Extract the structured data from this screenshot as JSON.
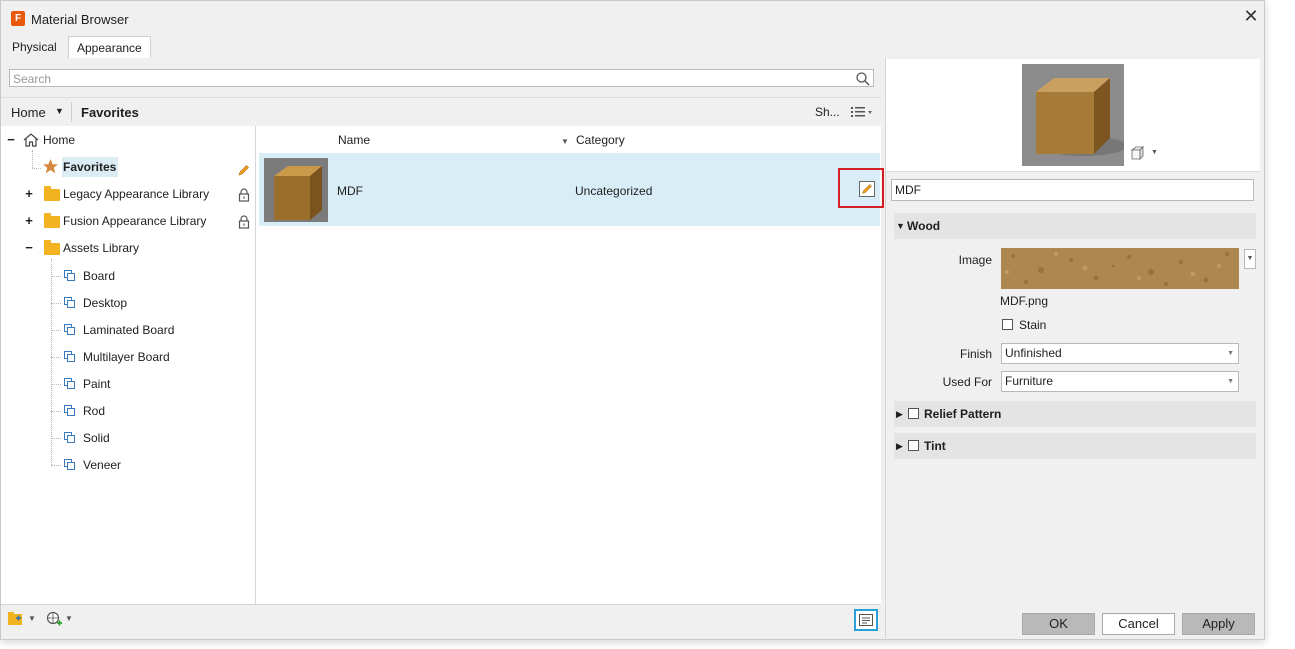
{
  "window": {
    "title": "Material Browser",
    "close_glyph": "✕"
  },
  "tabs": [
    {
      "label": "Physical"
    },
    {
      "label": "Appearance",
      "active": true
    }
  ],
  "search": {
    "placeholder": "Search",
    "value": ""
  },
  "breadcrumb": {
    "root": "Home",
    "current": "Favorites",
    "show_label": "Sh..."
  },
  "tree": {
    "home": {
      "label": "Home",
      "expanded": true
    },
    "favorites": {
      "label": "Favorites",
      "selected": true
    },
    "libraries": [
      {
        "label": "Legacy Appearance Library",
        "expanded": false,
        "locked": true
      },
      {
        "label": "Fusion Appearance Library",
        "expanded": false,
        "locked": true
      },
      {
        "label": "Assets Library",
        "expanded": true,
        "locked": false
      }
    ],
    "assets": [
      {
        "label": "Board"
      },
      {
        "label": "Desktop"
      },
      {
        "label": "Laminated Board"
      },
      {
        "label": "Multilayer Board"
      },
      {
        "label": "Paint"
      },
      {
        "label": "Rod"
      },
      {
        "label": "Solid"
      },
      {
        "label": "Veneer"
      }
    ],
    "expand_glyph": "+",
    "collapse_glyph": "−"
  },
  "list": {
    "columns": {
      "name": "Name",
      "category": "Category"
    },
    "rows": [
      {
        "name": "MDF",
        "category": "Uncategorized",
        "selected": true
      }
    ]
  },
  "editor": {
    "material_name": "MDF",
    "sections": {
      "wood": {
        "label": "Wood",
        "expanded": true
      },
      "relief": {
        "label": "Relief  Pattern",
        "checked": false,
        "expanded": false
      },
      "tint": {
        "label": "Tint",
        "checked": false,
        "expanded": false
      }
    },
    "image_label": "Image",
    "image_file": "MDF.png",
    "stain_label": "Stain",
    "stain_checked": false,
    "finish_label": "Finish",
    "finish_value": "Unfinished",
    "used_for_label": "Used For",
    "used_for_value": "Furniture"
  },
  "buttons": {
    "ok": "OK",
    "cancel": "Cancel",
    "apply": "Apply"
  },
  "colors": {
    "selection": "#d9edf7",
    "highlight_red": "#d51f26",
    "highlight_blue": "#2aa0d8",
    "folder": "#f3b21f",
    "wood": "#b08a52"
  }
}
